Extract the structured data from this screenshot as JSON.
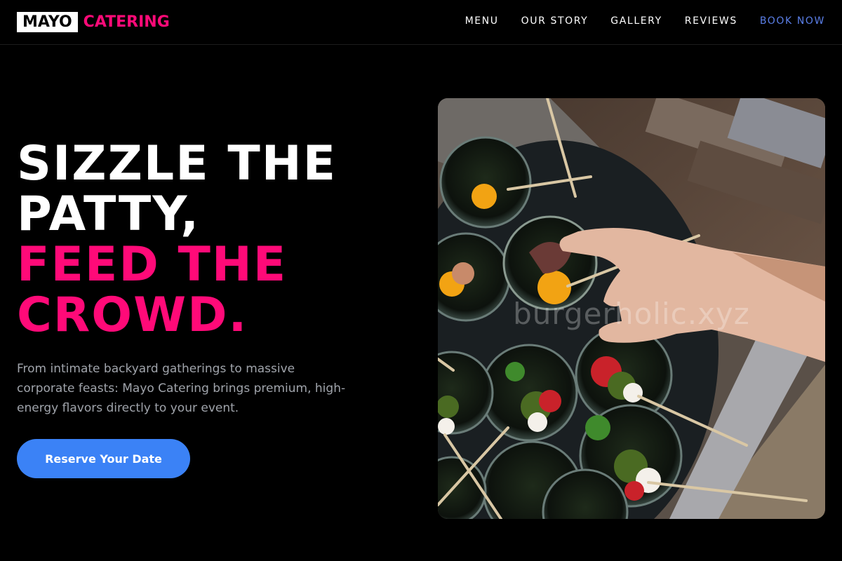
{
  "brand": {
    "name_part1": "MAYO",
    "name_part2": "CATERING"
  },
  "nav": {
    "items": [
      {
        "label": "MENU"
      },
      {
        "label": "OUR STORY"
      },
      {
        "label": "GALLERY"
      },
      {
        "label": "REVIEWS"
      },
      {
        "label": "BOOK NOW"
      }
    ]
  },
  "hero": {
    "headline_lines": [
      "SIZZLE THE",
      "PATTY,",
      "FEED THE",
      "CROWD."
    ],
    "subtitle": "From intimate backyard gatherings to massive corporate feasts: Mayo Catering brings premium, high-energy flavors directly to your event.",
    "cta_label": "Reserve Your Date"
  },
  "photo": {
    "watermark": "burgerholic.xyz"
  },
  "colors": {
    "accent_pink": "#ff0a78",
    "cta_blue": "#3b82f6",
    "nav_cta": "#5b7fe8",
    "background": "#000000"
  }
}
